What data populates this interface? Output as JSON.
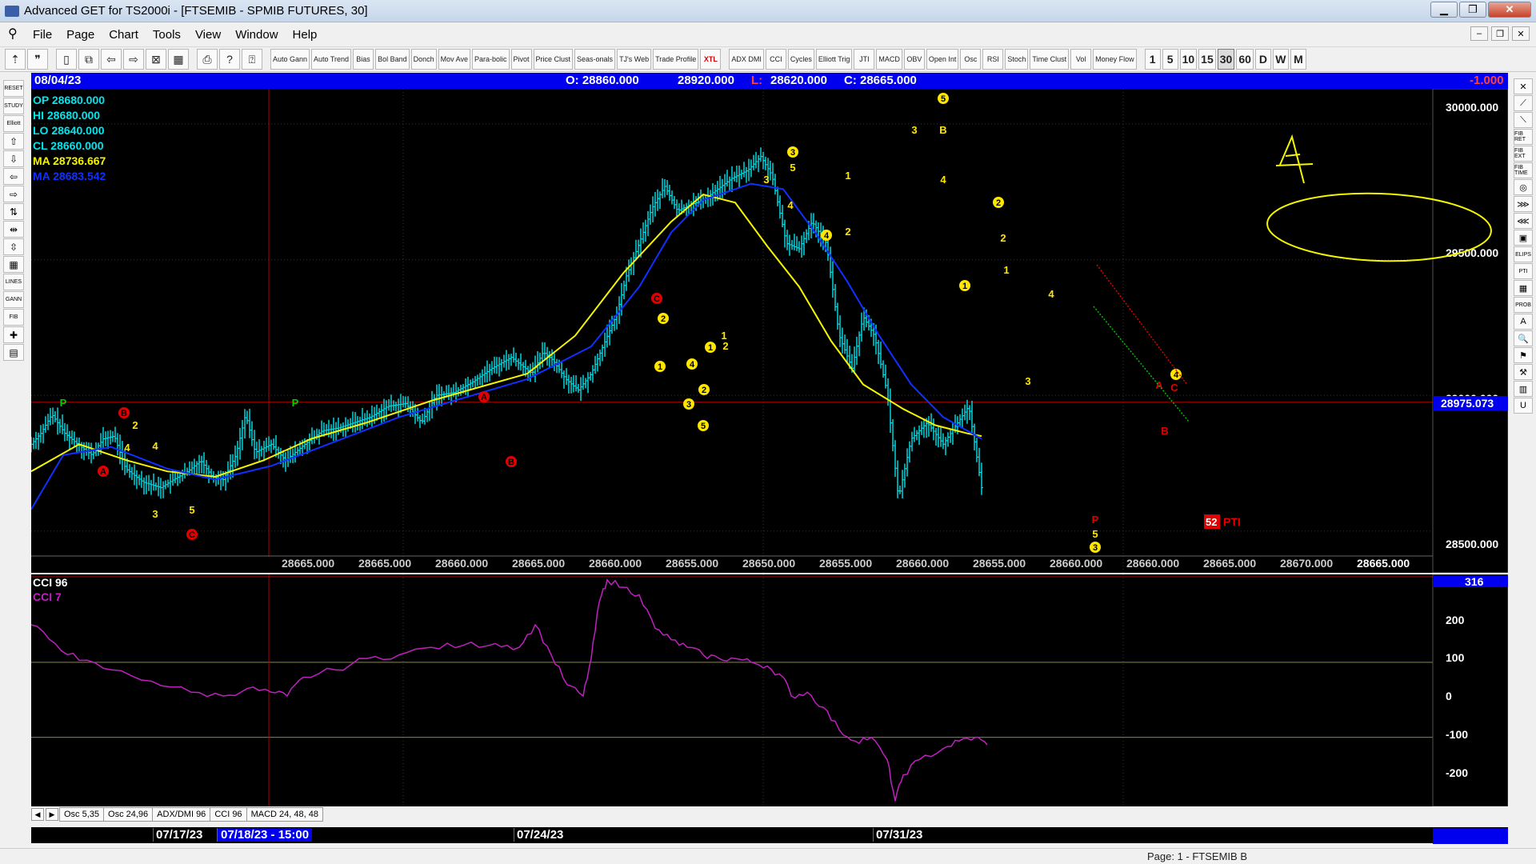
{
  "window": {
    "title": "Advanced GET for TS2000i - [FTSEMIB - SPMIB FUTURES, 30]",
    "minimize": "▁",
    "restore": "❐",
    "close": "✕"
  },
  "menu": {
    "items": [
      "File",
      "Page",
      "Chart",
      "Tools",
      "View",
      "Window",
      "Help"
    ]
  },
  "toolbar": {
    "study_buttons": [
      "Auto Gann",
      "Auto Trend",
      "Bias",
      "Bol Band",
      "Donch",
      "Mov Ave",
      "Para-bolic",
      "Pivot",
      "Price Clust",
      "Seas-onals",
      "TJ's Web",
      "Trade Profile",
      "XTL"
    ],
    "osc_buttons": [
      "ADX DMI",
      "CCI",
      "Cycles",
      "Elliott Trig",
      "JTI",
      "MACD",
      "OBV",
      "Open Int",
      "Osc",
      "RSI",
      "Stoch",
      "Time Clust",
      "Vol",
      "Money Flow"
    ],
    "periods": [
      "1",
      "5",
      "10",
      "15",
      "30",
      "60",
      "D",
      "W",
      "M"
    ],
    "active_period": "30"
  },
  "left_tools": [
    "RESET",
    "STUDY",
    "Elliott",
    "⇧",
    "⇩",
    "⇦",
    "⇨",
    "⇅",
    "⇹",
    "⇳",
    "▦",
    "LINES",
    "GANN",
    "FIB",
    "✚",
    "▤"
  ],
  "right_tools": [
    "✕",
    "⟋",
    "⟍",
    "FIB RET",
    "FIB EXT",
    "FIB TIME",
    "◎",
    "⋙",
    "⋘",
    "▣",
    "ELIPS",
    "PTI",
    "▦",
    "PROB",
    "A",
    "🔍",
    "⚑",
    "⚒",
    "▥",
    "U"
  ],
  "infobar": {
    "date": "08/04/23",
    "open": "O: 28860.000",
    "high": "28920.000",
    "low_label": "L:",
    "low": "28620.000",
    "close": "C: 28665.000",
    "change": "-1.000"
  },
  "legend": {
    "op": "OP  28680.000",
    "hi": "HI   28680.000",
    "lo": "LO  28640.000",
    "cl": "CL  28660.000",
    "ma1": "MA  28736.667",
    "ma2": "MA  28683.542"
  },
  "price_axis": {
    "ticks": [
      "30000.000",
      "29500.000",
      "29000.000",
      "28500.000"
    ],
    "current_price": "28975.073"
  },
  "bottom_price_row": [
    "28665.000",
    "28665.000",
    "28660.000",
    "28665.000",
    "28660.000",
    "28655.000",
    "28650.000",
    "28655.000",
    "28660.000",
    "28655.000",
    "28660.000",
    "28660.000",
    "28665.000",
    "28670.000"
  ],
  "bottom_price_current": "28665.000",
  "pti": {
    "value": "52",
    "label": "PTI"
  },
  "annotation": {
    "letter": "A"
  },
  "cci": {
    "label1": "CCI 96",
    "label2": "CCI  7",
    "current": "316",
    "ticks": [
      "200",
      "100",
      "0",
      "-100",
      "-200"
    ]
  },
  "bottom_tabs": [
    "Osc 5,35",
    "Osc 24,96",
    "ADX/DMI 96",
    "CCI 96",
    "MACD 24, 48, 48"
  ],
  "datebar": {
    "d1": "07/17/23",
    "d1_sel": "07/18/23 - 15:00",
    "d2": "07/24/23",
    "d3": "07/31/23"
  },
  "status": {
    "page": "Page: 1 - FTSEMIB B"
  },
  "colors": {
    "bars": "#00e5ee",
    "ma_fast": "#f5f500",
    "ma_slow": "#1030ff",
    "cci": "#c020c0",
    "wave_yellow": "#ffe600",
    "wave_red": "#e00000",
    "info_blue": "#0000ee"
  },
  "chart_data": {
    "type": "candlestick",
    "title": "FTSEMIB - SPMIB FUTURES, 30",
    "ylim": [
      28420,
      30100
    ],
    "path_points": [
      [
        0,
        28820
      ],
      [
        12,
        28860
      ],
      [
        26,
        28930
      ],
      [
        42,
        28860
      ],
      [
        58,
        28820
      ],
      [
        76,
        28780
      ],
      [
        90,
        28840
      ],
      [
        104,
        28850
      ],
      [
        118,
        28730
      ],
      [
        140,
        28680
      ],
      [
        162,
        28660
      ],
      [
        178,
        28690
      ],
      [
        196,
        28720
      ],
      [
        212,
        28760
      ],
      [
        226,
        28700
      ],
      [
        240,
        28690
      ],
      [
        256,
        28780
      ],
      [
        268,
        28930
      ],
      [
        280,
        28790
      ],
      [
        300,
        28820
      ],
      [
        318,
        28760
      ],
      [
        342,
        28820
      ],
      [
        364,
        28870
      ],
      [
        384,
        28880
      ],
      [
        404,
        28900
      ],
      [
        424,
        28920
      ],
      [
        446,
        28960
      ],
      [
        468,
        28970
      ],
      [
        488,
        28900
      ],
      [
        506,
        29000
      ],
      [
        528,
        29010
      ],
      [
        552,
        29050
      ],
      [
        576,
        29100
      ],
      [
        600,
        29140
      ],
      [
        626,
        29080
      ],
      [
        640,
        29160
      ],
      [
        652,
        29130
      ],
      [
        668,
        29060
      ],
      [
        684,
        29020
      ],
      [
        700,
        29080
      ],
      [
        716,
        29190
      ],
      [
        732,
        29300
      ],
      [
        744,
        29440
      ],
      [
        760,
        29560
      ],
      [
        776,
        29690
      ],
      [
        792,
        29770
      ],
      [
        808,
        29680
      ],
      [
        822,
        29700
      ],
      [
        840,
        29720
      ],
      [
        858,
        29760
      ],
      [
        876,
        29800
      ],
      [
        896,
        29830
      ],
      [
        912,
        29880
      ],
      [
        926,
        29810
      ],
      [
        944,
        29560
      ],
      [
        960,
        29540
      ],
      [
        976,
        29640
      ],
      [
        994,
        29560
      ],
      [
        1010,
        29220
      ],
      [
        1026,
        29100
      ],
      [
        1040,
        29290
      ],
      [
        1054,
        29220
      ],
      [
        1070,
        29010
      ],
      [
        1084,
        28620
      ],
      [
        1100,
        28840
      ],
      [
        1120,
        28900
      ],
      [
        1140,
        28820
      ],
      [
        1156,
        28890
      ],
      [
        1172,
        28960
      ],
      [
        1188,
        28660
      ]
    ],
    "ma_fast": [
      [
        0,
        28720
      ],
      [
        60,
        28820
      ],
      [
        120,
        28760
      ],
      [
        170,
        28720
      ],
      [
        230,
        28700
      ],
      [
        290,
        28760
      ],
      [
        350,
        28840
      ],
      [
        420,
        28900
      ],
      [
        500,
        28980
      ],
      [
        560,
        29030
      ],
      [
        620,
        29080
      ],
      [
        680,
        29220
      ],
      [
        740,
        29450
      ],
      [
        800,
        29640
      ],
      [
        840,
        29740
      ],
      [
        880,
        29710
      ],
      [
        920,
        29550
      ],
      [
        960,
        29400
      ],
      [
        1000,
        29200
      ],
      [
        1040,
        29040
      ],
      [
        1090,
        28950
      ],
      [
        1130,
        28890
      ],
      [
        1170,
        28860
      ],
      [
        1188,
        28850
      ]
    ],
    "ma_slow": [
      [
        0,
        28580
      ],
      [
        40,
        28780
      ],
      [
        100,
        28810
      ],
      [
        170,
        28730
      ],
      [
        230,
        28690
      ],
      [
        300,
        28740
      ],
      [
        380,
        28830
      ],
      [
        460,
        28920
      ],
      [
        540,
        28990
      ],
      [
        620,
        29060
      ],
      [
        700,
        29180
      ],
      [
        760,
        29400
      ],
      [
        800,
        29600
      ],
      [
        840,
        29720
      ],
      [
        900,
        29780
      ],
      [
        940,
        29760
      ],
      [
        980,
        29600
      ],
      [
        1020,
        29420
      ],
      [
        1060,
        29220
      ],
      [
        1100,
        29040
      ],
      [
        1140,
        28920
      ],
      [
        1188,
        28840
      ]
    ],
    "cci_series": [
      [
        0,
        200
      ],
      [
        30,
        150
      ],
      [
        60,
        105
      ],
      [
        100,
        80
      ],
      [
        150,
        50
      ],
      [
        200,
        20
      ],
      [
        240,
        10
      ],
      [
        270,
        30
      ],
      [
        300,
        20
      ],
      [
        320,
        10
      ],
      [
        340,
        60
      ],
      [
        380,
        80
      ],
      [
        420,
        110
      ],
      [
        460,
        120
      ],
      [
        500,
        140
      ],
      [
        540,
        145
      ],
      [
        580,
        150
      ],
      [
        610,
        140
      ],
      [
        630,
        200
      ],
      [
        650,
        120
      ],
      [
        670,
        40
      ],
      [
        690,
        10
      ],
      [
        700,
        110
      ],
      [
        710,
        260
      ],
      [
        720,
        320
      ],
      [
        740,
        300
      ],
      [
        760,
        280
      ],
      [
        780,
        190
      ],
      [
        800,
        160
      ],
      [
        820,
        140
      ],
      [
        840,
        120
      ],
      [
        860,
        110
      ],
      [
        880,
        110
      ],
      [
        900,
        100
      ],
      [
        920,
        90
      ],
      [
        940,
        60
      ],
      [
        950,
        10
      ],
      [
        970,
        20
      ],
      [
        990,
        -20
      ],
      [
        1010,
        -80
      ],
      [
        1030,
        -110
      ],
      [
        1050,
        -100
      ],
      [
        1070,
        -160
      ],
      [
        1080,
        -270
      ],
      [
        1090,
        -200
      ],
      [
        1110,
        -160
      ],
      [
        1140,
        -130
      ],
      [
        1160,
        -110
      ],
      [
        1180,
        -100
      ],
      [
        1195,
        -120
      ]
    ],
    "cci_ylim": [
      -280,
      330
    ],
    "x_domain": [
      0,
      1420
    ]
  }
}
